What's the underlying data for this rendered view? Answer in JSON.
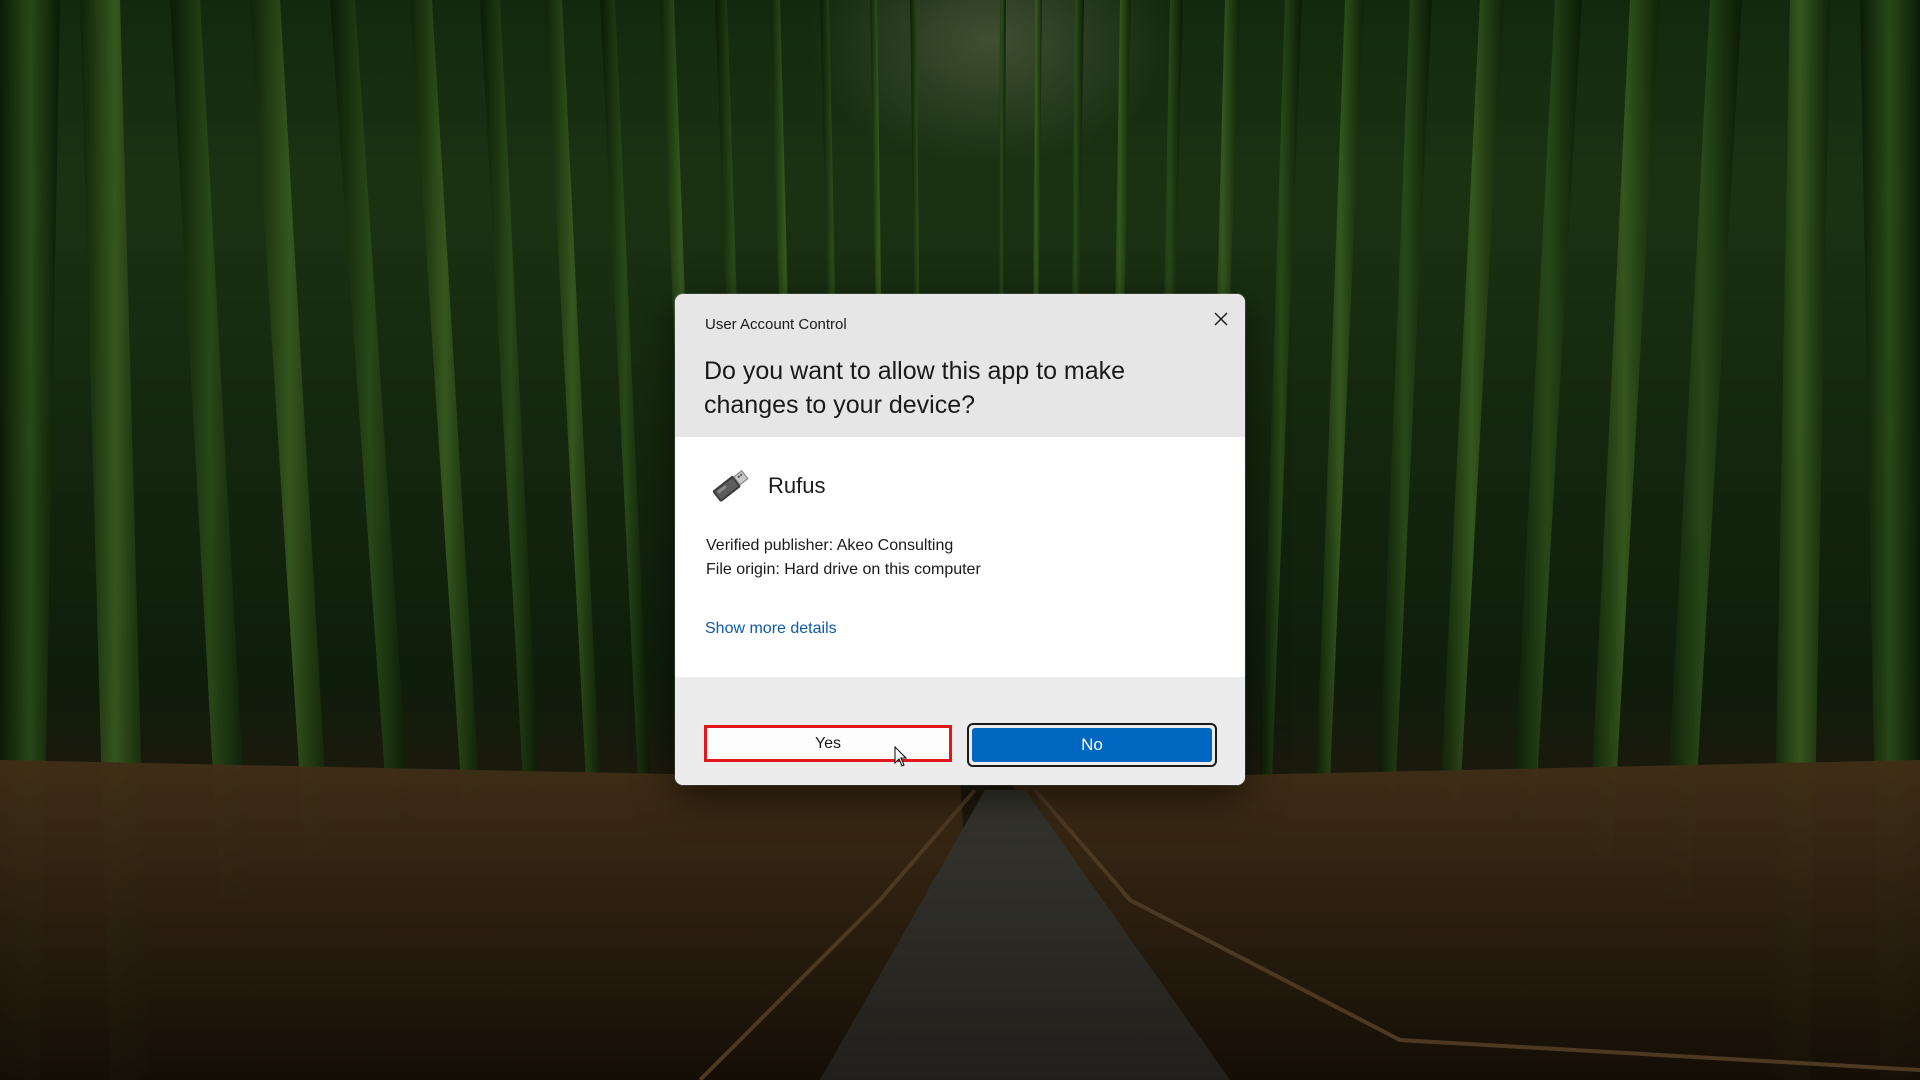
{
  "dialog": {
    "title": "User Account Control",
    "question": "Do you want to allow this app to make changes to your device?",
    "app_name": "Rufus",
    "app_icon": "usb-drive-icon",
    "publisher": "Verified publisher: Akeo Consulting",
    "file_origin": "File origin: Hard drive on this computer",
    "details_link": "Show more details",
    "yes_label": "Yes",
    "no_label": "No",
    "close_icon": "close-icon"
  },
  "colors": {
    "accent": "#0067c0",
    "link": "#0f5aa8",
    "highlight_outline": "#e2161d",
    "header_bg": "#e6e6e6",
    "footer_bg": "#ececec"
  }
}
